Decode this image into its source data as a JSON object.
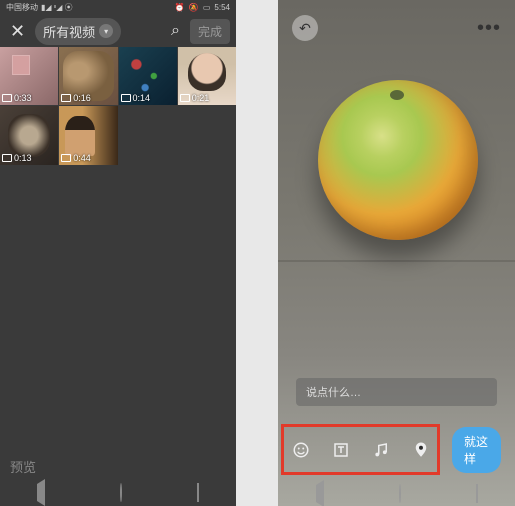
{
  "left": {
    "status": {
      "carrier": "中国移动",
      "signals": "▮◢ ᶦᶦ◢ ⦿",
      "alarm_icon": "⏰",
      "mute_icon": "🔕",
      "battery": "▭",
      "time": "5:54"
    },
    "header": {
      "close_label": "✕",
      "dropdown_label": "所有视频",
      "search_label": "⌕",
      "done_label": "完成"
    },
    "videos": [
      {
        "duration": "0:33"
      },
      {
        "duration": "0:16"
      },
      {
        "duration": "0:14"
      },
      {
        "duration": "0:21"
      },
      {
        "duration": "0:13"
      },
      {
        "duration": "0:44"
      }
    ],
    "preview_label": "预览"
  },
  "right": {
    "undo_label": "↶",
    "more_label": "•••",
    "caption_placeholder": "说点什么…",
    "toolbar": {
      "emoji": "emoji",
      "text": "text",
      "music": "music",
      "location": "location"
    },
    "publish_label": "就这样"
  }
}
